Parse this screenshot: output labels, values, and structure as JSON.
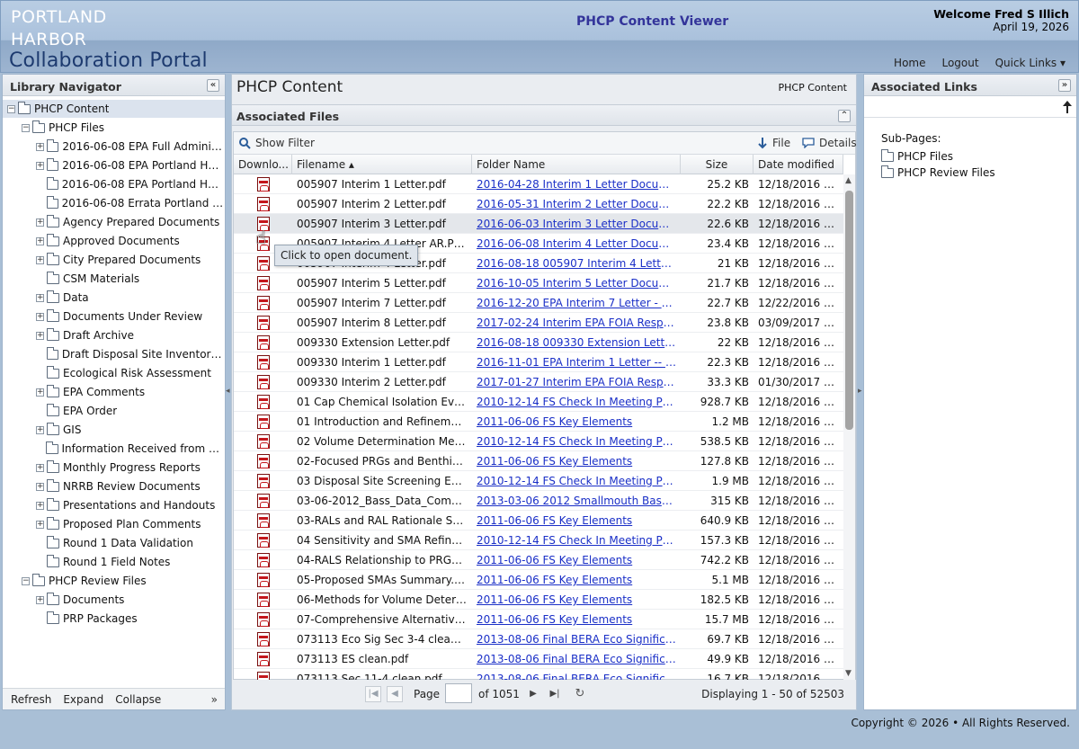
{
  "header": {
    "logo_line1": "PORTLAND",
    "logo_line2": "HARBOR",
    "logo_line3": "Collaboration Portal",
    "app_title": "PHCP Content Viewer",
    "welcome": "Welcome Fred S Illich",
    "date": "April 19, 2026",
    "nav_home": "Home",
    "nav_logout": "Logout",
    "nav_quick_links": "Quick Links ▾"
  },
  "library": {
    "title": "Library Navigator",
    "collapse_icon": "«",
    "tree": [
      {
        "label": "PHCP Content",
        "level": 0,
        "expander": "−",
        "selected": true
      },
      {
        "label": "PHCP Files",
        "level": 1,
        "expander": "−"
      },
      {
        "label": "2016-06-08 EPA Full Administr...",
        "level": 2,
        "expander": "+"
      },
      {
        "label": "2016-06-08 EPA Portland Harb...",
        "level": 2,
        "expander": "+"
      },
      {
        "label": "2016-06-08 EPA Portland Harb...",
        "level": 2,
        "expander": ""
      },
      {
        "label": "2016-06-08 Errata Portland Ha...",
        "level": 2,
        "expander": ""
      },
      {
        "label": "Agency Prepared Documents",
        "level": 2,
        "expander": "+"
      },
      {
        "label": "Approved Documents",
        "level": 2,
        "expander": "+"
      },
      {
        "label": "City Prepared Documents",
        "level": 2,
        "expander": "+"
      },
      {
        "label": "CSM Materials",
        "level": 2,
        "expander": ""
      },
      {
        "label": "Data",
        "level": 2,
        "expander": "+"
      },
      {
        "label": "Documents Under Review",
        "level": 2,
        "expander": "+"
      },
      {
        "label": "Draft Archive",
        "level": 2,
        "expander": "+"
      },
      {
        "label": "Draft Disposal Site Inventory P...",
        "level": 2,
        "expander": ""
      },
      {
        "label": "Ecological Risk Assessment",
        "level": 2,
        "expander": ""
      },
      {
        "label": "EPA Comments",
        "level": 2,
        "expander": "+"
      },
      {
        "label": "EPA Order",
        "level": 2,
        "expander": ""
      },
      {
        "label": "GIS",
        "level": 2,
        "expander": "+"
      },
      {
        "label": "Information Received from EPA...",
        "level": 2,
        "expander": ""
      },
      {
        "label": "Monthly Progress Reports",
        "level": 2,
        "expander": "+"
      },
      {
        "label": "NRRB Review Documents",
        "level": 2,
        "expander": "+"
      },
      {
        "label": "Presentations and Handouts",
        "level": 2,
        "expander": "+"
      },
      {
        "label": "Proposed Plan Comments",
        "level": 2,
        "expander": "+"
      },
      {
        "label": "Round 1 Data Validation",
        "level": 2,
        "expander": ""
      },
      {
        "label": "Round 1 Field Notes",
        "level": 2,
        "expander": ""
      },
      {
        "label": "PHCP Review Files",
        "level": 1,
        "expander": "−"
      },
      {
        "label": "Documents",
        "level": 2,
        "expander": "+"
      },
      {
        "label": "PRP Packages",
        "level": 2,
        "expander": ""
      }
    ],
    "footer_refresh": "Refresh",
    "footer_expand": "Expand",
    "footer_collapse": "Collapse",
    "footer_more": "»"
  },
  "content": {
    "title": "PHCP Content",
    "breadcrumb": "PHCP Content",
    "section": "Associated Files",
    "section_collapse_icon": "⌃",
    "toolbar": {
      "show_filter": "Show Filter",
      "file": "File",
      "details": "Details"
    },
    "columns": [
      "Downlo...",
      "Filename ▴",
      "Folder Name",
      "Size",
      "Date modified"
    ],
    "rows": [
      {
        "filename": "005907 Interim 1 Letter.pdf",
        "folder": "2016-04-28  Interim 1 Letter Document...",
        "size": "25.2 KB",
        "date": "12/18/2016 0..."
      },
      {
        "filename": "005907 Interim 2 Letter.pdf",
        "folder": "2016-05-31  Interim 2 Letter Document...",
        "size": "22.2 KB",
        "date": "12/18/2016 0..."
      },
      {
        "filename": "005907 Interim 3 Letter.pdf",
        "folder": "2016-06-03 Interim 3 Letter Document...",
        "size": "22.6 KB",
        "date": "12/18/2016 0..."
      },
      {
        "filename": "005907 Interim 4 Letter AR.PDF",
        "folder": "2016-06-08 Interim 4 Letter Document...",
        "size": "23.4 KB",
        "date": "12/18/2016 0..."
      },
      {
        "filename": "005907 Interim 4 Letter.pdf",
        "folder": "2016-08-18 005907 Interim 4 Letter Do...",
        "size": "21 KB",
        "date": "12/18/2016 0..."
      },
      {
        "filename": "005907 Interim 5 Letter.pdf",
        "folder": "2016-10-05  Interim 5 Letter Document...",
        "size": "21.7 KB",
        "date": "12/18/2016 0..."
      },
      {
        "filename": "005907 Interim 7 Letter.pdf",
        "folder": "2016-12-20 EPA Interim 7 Letter - LWG...",
        "size": "22.7 KB",
        "date": "12/22/2016 0..."
      },
      {
        "filename": "005907 Interim 8 Letter.pdf",
        "folder": "2017-02-24 Interim EPA FOIA Respons...",
        "size": "23.8 KB",
        "date": "03/09/2017 0..."
      },
      {
        "filename": "009330 Extension Letter.pdf",
        "folder": "2016-08-18 009330 Extension Letter D...",
        "size": "22 KB",
        "date": "12/18/2016 0..."
      },
      {
        "filename": "009330 Interim 1 Letter.pdf",
        "folder": "2016-11-01 EPA Interim 1 Letter -- LW...",
        "size": "22.3 KB",
        "date": "12/18/2016 0..."
      },
      {
        "filename": "009330 Interim 2 Letter.pdf",
        "folder": "2017-01-27 Interim EPA FOIA Respons...",
        "size": "33.3 KB",
        "date": "01/30/2017 0..."
      },
      {
        "filename": "01 Cap Chemical Isolation Evalua...",
        "folder": "2010-12-14  FS Check In Meeting Prese...",
        "size": "928.7 KB",
        "date": "12/18/2016 0..."
      },
      {
        "filename": "01 Introduction and Refinements ...",
        "folder": "2011-06-06  FS Key Elements",
        "size": "1.2 MB",
        "date": "12/18/2016 0..."
      },
      {
        "filename": "02 Volume Determination Method...",
        "folder": "2010-12-14  FS Check In Meeting Prese...",
        "size": "538.5 KB",
        "date": "12/18/2016 0..."
      },
      {
        "filename": "02-Focused PRGs and Benthic SQ...",
        "folder": "2011-06-06  FS Key Elements",
        "size": "127.8 KB",
        "date": "12/18/2016 0..."
      },
      {
        "filename": "03 Disposal Site Screening Evalua...",
        "folder": "2010-12-14  FS Check In Meeting Prese...",
        "size": "1.9 MB",
        "date": "12/18/2016 0..."
      },
      {
        "filename": "03-06-2012_Bass_Data_Compari...",
        "folder": "2013-03-06  2012 Smallmouth Bass Tis...",
        "size": "315 KB",
        "date": "12/18/2016 0..."
      },
      {
        "filename": "03-RALs and RAL Rationale Sum...",
        "folder": "2011-06-06  FS Key Elements",
        "size": "640.9 KB",
        "date": "12/18/2016 0..."
      },
      {
        "filename": "04 Sensitivity and SMA Refineme...",
        "folder": "2010-12-14  FS Check In Meeting Prese...",
        "size": "157.3 KB",
        "date": "12/18/2016 0..."
      },
      {
        "filename": "04-RALS Relationship to PRGs.pdf",
        "folder": "2011-06-06  FS Key Elements",
        "size": "742.2 KB",
        "date": "12/18/2016 0..."
      },
      {
        "filename": "05-Proposed SMAs Summary.pdf",
        "folder": "2011-06-06  FS Key Elements",
        "size": "5.1 MB",
        "date": "12/18/2016 0..."
      },
      {
        "filename": "06-Methods for Volume Determin...",
        "folder": "2011-06-06  FS Key Elements",
        "size": "182.5 KB",
        "date": "12/18/2016 0..."
      },
      {
        "filename": "07-Comprehensive Alternatives S...",
        "folder": "2011-06-06  FS Key Elements",
        "size": "15.7 MB",
        "date": "12/18/2016 0..."
      },
      {
        "filename": "073113 Eco Sig Sec 3-4 clean.pdf",
        "folder": "2013-08-06  Final BERA Eco Significanc...",
        "size": "69.7 KB",
        "date": "12/18/2016 0..."
      },
      {
        "filename": "073113 ES clean.pdf",
        "folder": "2013-08-06  Final BERA Eco Significanc...",
        "size": "49.9 KB",
        "date": "12/18/2016 0..."
      },
      {
        "filename": "073113 Sec 11-4 clean.pdf",
        "folder": "2013-08-06  Final BERA Eco Significanc...",
        "size": "16.7 KB",
        "date": "12/18/2016 0..."
      }
    ],
    "hover_row": 2,
    "tooltip": "Click to open document.",
    "pager": {
      "first_icon": "|◀",
      "prev_icon": "◀",
      "page_label": "Page",
      "page_value": "",
      "of_label": "of 1051",
      "next_icon": "▶",
      "last_icon": "▶|",
      "refresh_icon": "↻",
      "displaying": "Displaying 1 - 50 of 52503"
    }
  },
  "associated_links": {
    "title": "Associated Links",
    "collapse_icon": "»",
    "up_icon": "🡑",
    "sub_pages_label": "Sub-Pages:",
    "sub_pages": [
      "PHCP Files",
      "PHCP Review Files"
    ]
  },
  "footer": {
    "copyright": "Copyright © 2026 • All Rights Reserved."
  },
  "colors": {
    "link": "#1a2fc7",
    "title_blue": "#33349a",
    "header_bg": "#aac1dc"
  }
}
